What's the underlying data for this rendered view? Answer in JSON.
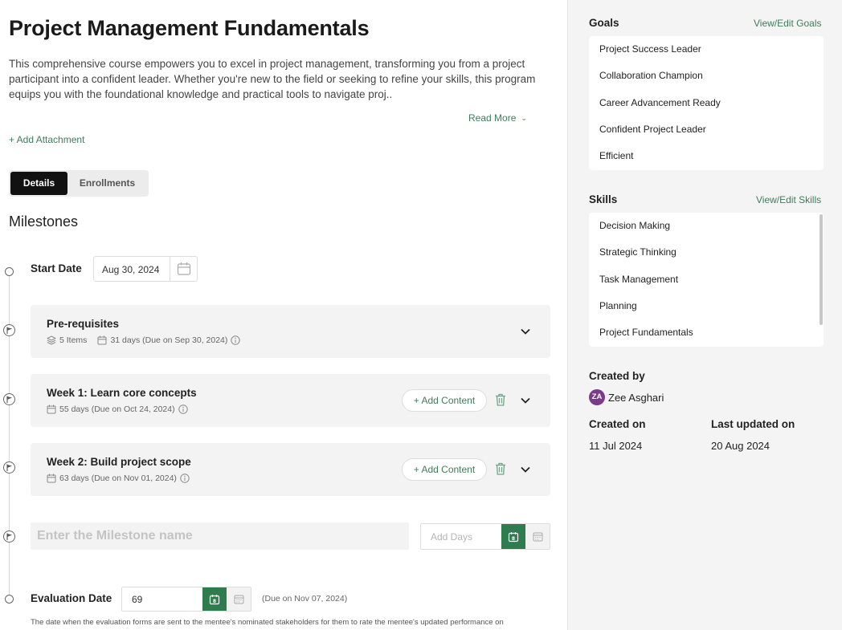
{
  "course": {
    "title": "Project Management Fundamentals",
    "description": "This comprehensive course empowers you to excel in project management, transforming you from a project participant into a confident leader. Whether you're new to the field or seeking to refine your skills, this program equips you with the foundational knowledge and practical tools to navigate proj..",
    "read_more": "Read More",
    "add_attachment": "+ Add Attachment"
  },
  "tabs": [
    {
      "label": "Details",
      "active": true
    },
    {
      "label": "Enrollments",
      "active": false
    }
  ],
  "milestones": {
    "heading": "Milestones",
    "start": {
      "label": "Start Date",
      "value": "Aug 30, 2024"
    },
    "items": [
      {
        "title": "Pre-requisites",
        "items_count": "5 Items",
        "duration": "31 days",
        "due": "(Due on Sep 30, 2024)",
        "has_add_content": false
      },
      {
        "title": "Week 1: Learn core concepts",
        "duration": "55 days",
        "due": "(Due on Oct 24, 2024)",
        "has_add_content": true
      },
      {
        "title": "Week 2: Build project scope",
        "duration": "63 days",
        "due": "(Due on Nov 01, 2024)",
        "has_add_content": true
      }
    ],
    "add_content_label": "+ Add Content",
    "new_milestone": {
      "placeholder": "Enter the Milestone name",
      "days_placeholder": "Add Days"
    },
    "evaluation": {
      "label": "Evaluation Date",
      "value": "69",
      "due": "(Due on Nov 07, 2024)",
      "note": "The date when the evaluation forms are sent to the mentee's nominated stakeholders for them to rate the mentee's updated performance on"
    }
  },
  "sidebar": {
    "goals": {
      "heading": "Goals",
      "link": "View/Edit Goals",
      "items": [
        "Project Success Leader",
        "Collaboration Champion",
        "Career Advancement Ready",
        "Confident Project Leader",
        "Efficient"
      ]
    },
    "skills": {
      "heading": "Skills",
      "link": "View/Edit Skills",
      "items": [
        "Decision Making",
        "Strategic Thinking",
        "Task Management",
        "Planning",
        "Project Fundamentals"
      ]
    },
    "created_by": {
      "label": "Created by",
      "initials": "ZA",
      "name": "Zee Asghari"
    },
    "created_on": {
      "label": "Created on",
      "value": "11 Jul 2024"
    },
    "last_updated": {
      "label": "Last updated on",
      "value": "20 Aug 2024"
    }
  },
  "colors": {
    "accent": "#3f7c5b",
    "button_green": "#2f7d4f",
    "avatar": "#7b3a8c"
  }
}
